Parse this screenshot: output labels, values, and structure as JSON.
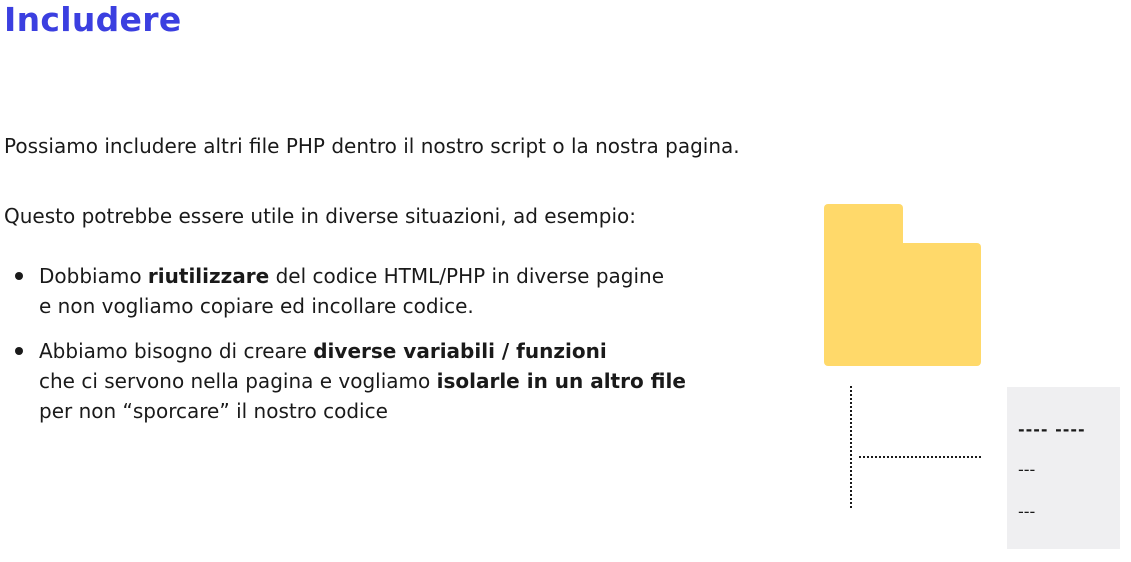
{
  "slide": {
    "title": "Includere",
    "intro": "Possiamo includere altri file PHP dentro il nostro script o la nostra pagina.",
    "lead": "Questo potrebbe essere utile in diverse situazioni, ad esempio:",
    "bullets": [
      {
        "l1_a": "Dobbiamo ",
        "l1_b": "riutilizzare",
        "l1_c": " del codice HTML/PHP in diverse pagine",
        "l2": "e non vogliamo copiare ed incollare codice."
      },
      {
        "l1_a": "Abbiamo bisogno di creare ",
        "l1_b": "diverse variabili / funzioni",
        "l2_a": "che ci servono nella pagina e vogliamo ",
        "l2_b": "isolarle in un altro file",
        "l3": "per non “sporcare” il nostro codice"
      }
    ]
  },
  "illustration": {
    "folder_icon": "folder-icon",
    "folder_color": "#ffd96a",
    "file_card_color": "#efeff1",
    "file_lines": [
      "---- ----",
      "---",
      "---"
    ]
  },
  "colors": {
    "title": "#3b3fe0",
    "text": "#1a1a1a"
  }
}
